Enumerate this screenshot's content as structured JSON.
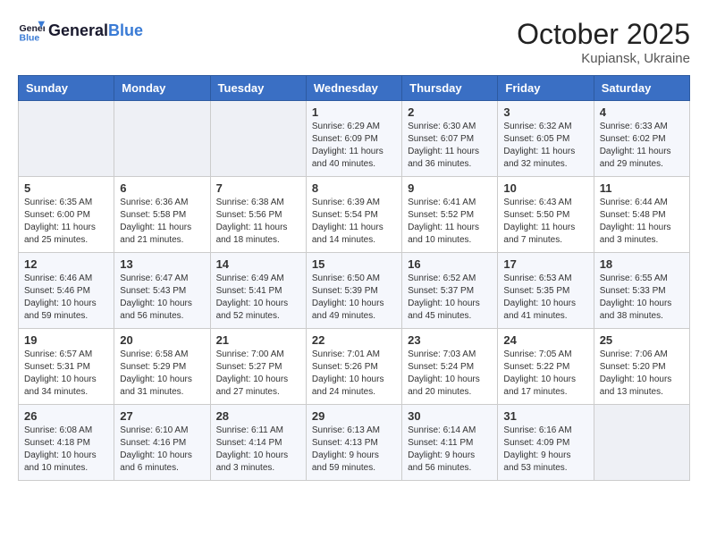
{
  "header": {
    "logo_line1": "General",
    "logo_line2": "Blue",
    "month_title": "October 2025",
    "subtitle": "Kupiansk, Ukraine"
  },
  "weekdays": [
    "Sunday",
    "Monday",
    "Tuesday",
    "Wednesday",
    "Thursday",
    "Friday",
    "Saturday"
  ],
  "weeks": [
    [
      {
        "day": "",
        "info": ""
      },
      {
        "day": "",
        "info": ""
      },
      {
        "day": "",
        "info": ""
      },
      {
        "day": "1",
        "info": "Sunrise: 6:29 AM\nSunset: 6:09 PM\nDaylight: 11 hours\nand 40 minutes."
      },
      {
        "day": "2",
        "info": "Sunrise: 6:30 AM\nSunset: 6:07 PM\nDaylight: 11 hours\nand 36 minutes."
      },
      {
        "day": "3",
        "info": "Sunrise: 6:32 AM\nSunset: 6:05 PM\nDaylight: 11 hours\nand 32 minutes."
      },
      {
        "day": "4",
        "info": "Sunrise: 6:33 AM\nSunset: 6:02 PM\nDaylight: 11 hours\nand 29 minutes."
      }
    ],
    [
      {
        "day": "5",
        "info": "Sunrise: 6:35 AM\nSunset: 6:00 PM\nDaylight: 11 hours\nand 25 minutes."
      },
      {
        "day": "6",
        "info": "Sunrise: 6:36 AM\nSunset: 5:58 PM\nDaylight: 11 hours\nand 21 minutes."
      },
      {
        "day": "7",
        "info": "Sunrise: 6:38 AM\nSunset: 5:56 PM\nDaylight: 11 hours\nand 18 minutes."
      },
      {
        "day": "8",
        "info": "Sunrise: 6:39 AM\nSunset: 5:54 PM\nDaylight: 11 hours\nand 14 minutes."
      },
      {
        "day": "9",
        "info": "Sunrise: 6:41 AM\nSunset: 5:52 PM\nDaylight: 11 hours\nand 10 minutes."
      },
      {
        "day": "10",
        "info": "Sunrise: 6:43 AM\nSunset: 5:50 PM\nDaylight: 11 hours\nand 7 minutes."
      },
      {
        "day": "11",
        "info": "Sunrise: 6:44 AM\nSunset: 5:48 PM\nDaylight: 11 hours\nand 3 minutes."
      }
    ],
    [
      {
        "day": "12",
        "info": "Sunrise: 6:46 AM\nSunset: 5:46 PM\nDaylight: 10 hours\nand 59 minutes."
      },
      {
        "day": "13",
        "info": "Sunrise: 6:47 AM\nSunset: 5:43 PM\nDaylight: 10 hours\nand 56 minutes."
      },
      {
        "day": "14",
        "info": "Sunrise: 6:49 AM\nSunset: 5:41 PM\nDaylight: 10 hours\nand 52 minutes."
      },
      {
        "day": "15",
        "info": "Sunrise: 6:50 AM\nSunset: 5:39 PM\nDaylight: 10 hours\nand 49 minutes."
      },
      {
        "day": "16",
        "info": "Sunrise: 6:52 AM\nSunset: 5:37 PM\nDaylight: 10 hours\nand 45 minutes."
      },
      {
        "day": "17",
        "info": "Sunrise: 6:53 AM\nSunset: 5:35 PM\nDaylight: 10 hours\nand 41 minutes."
      },
      {
        "day": "18",
        "info": "Sunrise: 6:55 AM\nSunset: 5:33 PM\nDaylight: 10 hours\nand 38 minutes."
      }
    ],
    [
      {
        "day": "19",
        "info": "Sunrise: 6:57 AM\nSunset: 5:31 PM\nDaylight: 10 hours\nand 34 minutes."
      },
      {
        "day": "20",
        "info": "Sunrise: 6:58 AM\nSunset: 5:29 PM\nDaylight: 10 hours\nand 31 minutes."
      },
      {
        "day": "21",
        "info": "Sunrise: 7:00 AM\nSunset: 5:27 PM\nDaylight: 10 hours\nand 27 minutes."
      },
      {
        "day": "22",
        "info": "Sunrise: 7:01 AM\nSunset: 5:26 PM\nDaylight: 10 hours\nand 24 minutes."
      },
      {
        "day": "23",
        "info": "Sunrise: 7:03 AM\nSunset: 5:24 PM\nDaylight: 10 hours\nand 20 minutes."
      },
      {
        "day": "24",
        "info": "Sunrise: 7:05 AM\nSunset: 5:22 PM\nDaylight: 10 hours\nand 17 minutes."
      },
      {
        "day": "25",
        "info": "Sunrise: 7:06 AM\nSunset: 5:20 PM\nDaylight: 10 hours\nand 13 minutes."
      }
    ],
    [
      {
        "day": "26",
        "info": "Sunrise: 6:08 AM\nSunset: 4:18 PM\nDaylight: 10 hours\nand 10 minutes."
      },
      {
        "day": "27",
        "info": "Sunrise: 6:10 AM\nSunset: 4:16 PM\nDaylight: 10 hours\nand 6 minutes."
      },
      {
        "day": "28",
        "info": "Sunrise: 6:11 AM\nSunset: 4:14 PM\nDaylight: 10 hours\nand 3 minutes."
      },
      {
        "day": "29",
        "info": "Sunrise: 6:13 AM\nSunset: 4:13 PM\nDaylight: 9 hours\nand 59 minutes."
      },
      {
        "day": "30",
        "info": "Sunrise: 6:14 AM\nSunset: 4:11 PM\nDaylight: 9 hours\nand 56 minutes."
      },
      {
        "day": "31",
        "info": "Sunrise: 6:16 AM\nSunset: 4:09 PM\nDaylight: 9 hours\nand 53 minutes."
      },
      {
        "day": "",
        "info": ""
      }
    ]
  ]
}
